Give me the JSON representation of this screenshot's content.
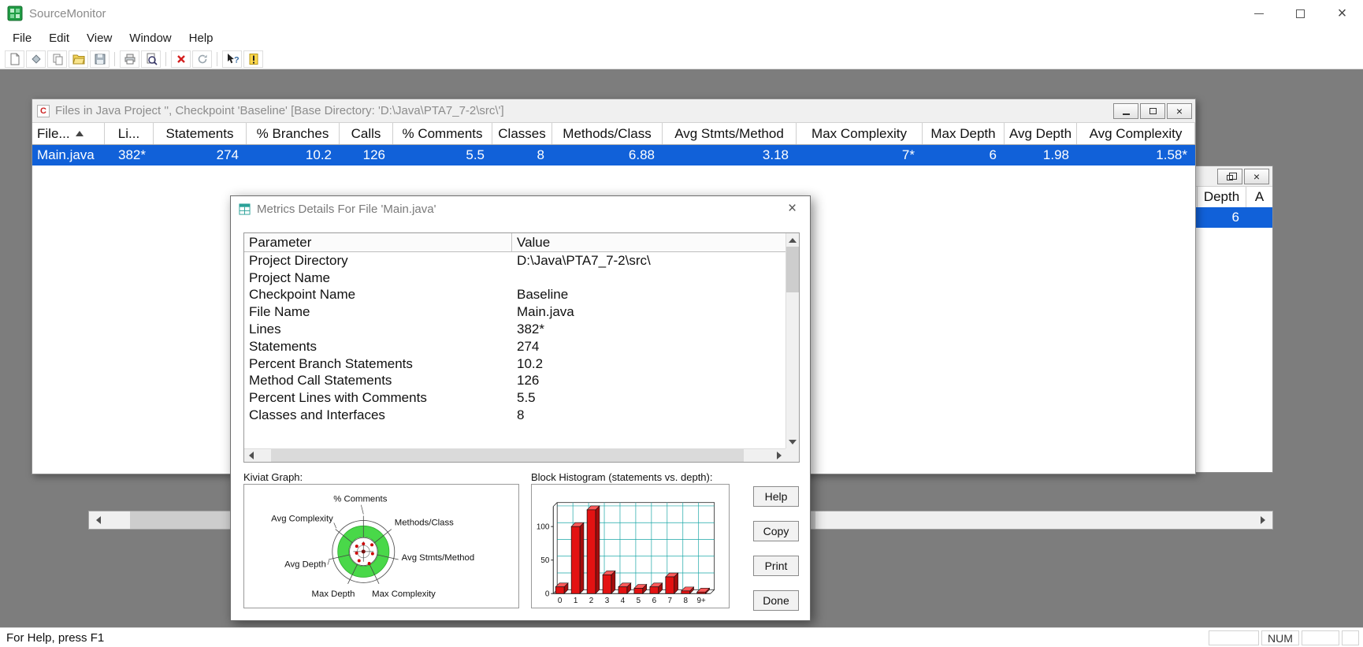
{
  "app": {
    "title": "SourceMonitor"
  },
  "menu": {
    "items": [
      "File",
      "Edit",
      "View",
      "Window",
      "Help"
    ]
  },
  "toolbar": {
    "buttons": [
      "new-file",
      "checkpoint-diamond",
      "copy",
      "open-project",
      "save",
      "print",
      "print-preview",
      "delete",
      "refresh",
      "context-help",
      "file-details"
    ]
  },
  "icons": {
    "close": "×",
    "question": "?",
    "files_glyph": "C",
    "sort": "ascending"
  },
  "files_window": {
    "title": "Files in Java Project '', Checkpoint 'Baseline'  [Base Directory: 'D:\\Java\\PTA7_7-2\\src\\']",
    "columns": [
      "File...",
      "Li...",
      "Statements",
      "% Branches",
      "Calls",
      "% Comments",
      "Classes",
      "Methods/Class",
      "Avg Stmts/Method",
      "Max Complexity",
      "Max Depth",
      "Avg Depth",
      "Avg Complexity"
    ],
    "row": {
      "file": "Main.java",
      "values": [
        "382*",
        "274",
        "10.2",
        "126",
        "5.5",
        "8",
        "6.88",
        "3.18",
        "7*",
        "6",
        "1.98",
        "1.58*"
      ]
    }
  },
  "partial_window": {
    "columns": [
      "Depth",
      "A"
    ],
    "cell": "6"
  },
  "dialog": {
    "title": "Metrics Details For File 'Main.java'",
    "grid": {
      "headers": [
        "Parameter",
        "Value"
      ],
      "rows": [
        {
          "param": "Project Directory",
          "value": "D:\\Java\\PTA7_7-2\\src\\"
        },
        {
          "param": "Project Name",
          "value": ""
        },
        {
          "param": "Checkpoint Name",
          "value": "Baseline"
        },
        {
          "param": "File Name",
          "value": "Main.java"
        },
        {
          "param": "Lines",
          "value": "382*"
        },
        {
          "param": "Statements",
          "value": "274"
        },
        {
          "param": "Percent Branch Statements",
          "value": "10.2"
        },
        {
          "param": "Method Call Statements",
          "value": "126"
        },
        {
          "param": "Percent Lines with Comments",
          "value": "5.5"
        },
        {
          "param": "Classes and Interfaces",
          "value": "8"
        }
      ]
    },
    "kiviat_label": "Kiviat Graph:",
    "histogram_label": "Block Histogram (statements vs. depth):",
    "buttons": [
      "Help",
      "Copy",
      "Print",
      "Done"
    ]
  },
  "chart_data": [
    {
      "type": "bar",
      "title": "Block Histogram (statements vs. depth)",
      "categories": [
        "0",
        "1",
        "2",
        "3",
        "4",
        "5",
        "6",
        "7",
        "8",
        "9+"
      ],
      "values": [
        10,
        100,
        125,
        28,
        10,
        8,
        10,
        25,
        4,
        2
      ],
      "yticks": [
        0,
        50,
        100
      ],
      "ylim": [
        0,
        130
      ],
      "bar_color": "#e31212"
    },
    {
      "type": "radar",
      "title": "Kiviat Graph",
      "axes": [
        "% Comments",
        "Methods/Class",
        "Avg Stmts/Method",
        "Max Complexity",
        "Max Depth",
        "Avg Depth",
        "Avg Complexity"
      ]
    }
  ],
  "status_bar": {
    "help_text": "For Help, press F1",
    "panes": [
      "",
      "NUM",
      "",
      ""
    ]
  }
}
